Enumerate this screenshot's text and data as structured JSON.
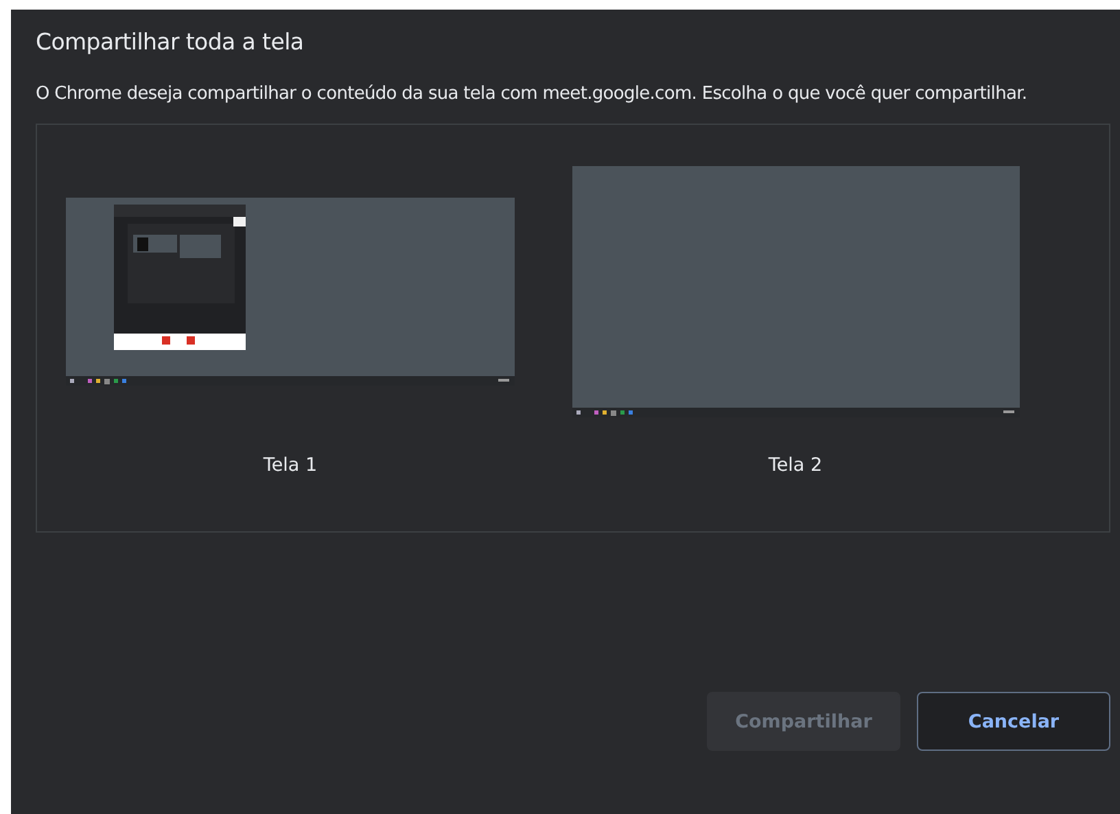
{
  "dialog": {
    "title": "Compartilhar toda a tela",
    "description": "O Chrome deseja compartilhar o conteúdo da sua tela com meet.google.com. Escolha o que você quer compartilhar."
  },
  "screens": [
    {
      "label": "Tela 1",
      "kind": "with_window"
    },
    {
      "label": "Tela 2",
      "kind": "empty"
    }
  ],
  "buttons": [
    {
      "label": "Compartilhar",
      "disabled": true
    },
    {
      "label": "Cancelar",
      "disabled": false
    }
  ]
}
